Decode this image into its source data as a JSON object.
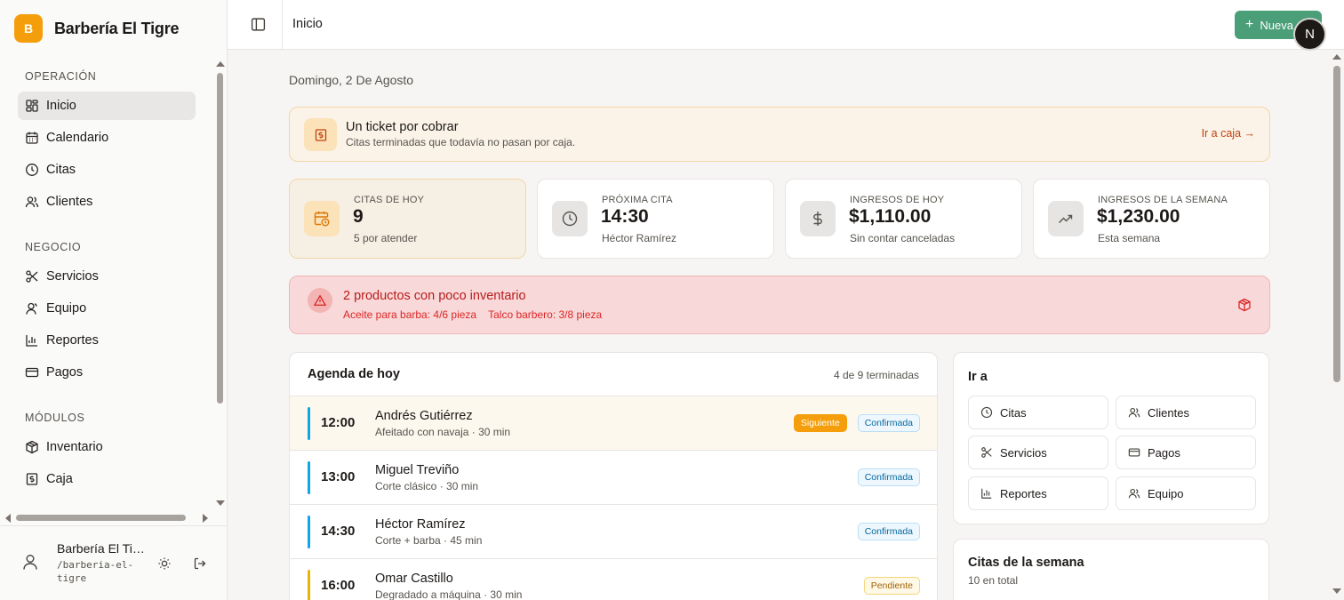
{
  "brand": {
    "initial": "B",
    "name": "Barbería El Tigre"
  },
  "sidebar": {
    "sections": [
      {
        "title": "OPERACIÓN",
        "items": [
          {
            "label": "Inicio",
            "icon": "grid-icon",
            "active": true
          },
          {
            "label": "Calendario",
            "icon": "calendar-icon"
          },
          {
            "label": "Citas",
            "icon": "clock-icon"
          },
          {
            "label": "Clientes",
            "icon": "users-icon"
          }
        ]
      },
      {
        "title": "NEGOCIO",
        "items": [
          {
            "label": "Servicios",
            "icon": "scissors-icon"
          },
          {
            "label": "Equipo",
            "icon": "team-icon"
          },
          {
            "label": "Reportes",
            "icon": "bar-chart-icon"
          },
          {
            "label": "Pagos",
            "icon": "credit-card-icon"
          }
        ]
      },
      {
        "title": "MÓDULOS",
        "items": [
          {
            "label": "Inventario",
            "icon": "box-icon"
          },
          {
            "label": "Caja",
            "icon": "cash-register-icon"
          }
        ]
      }
    ],
    "footer": {
      "name": "Barbería El Ti…",
      "slug": "/barberia-el-tigre"
    }
  },
  "header": {
    "title": "Inicio",
    "new_button": "Nueva",
    "avatar_initial": "N"
  },
  "main": {
    "date": "Domingo, 2 De Agosto",
    "ticket_banner": {
      "title": "Un ticket por cobrar",
      "subtitle": "Citas terminadas que todavía no pasan por caja.",
      "link": "Ir a caja →"
    },
    "stats": [
      {
        "label": "CITAS DE HOY",
        "value": "9",
        "sub": "5 por atender",
        "icon": "calendar-clock-icon"
      },
      {
        "label": "PRÓXIMA CITA",
        "value": "14:30",
        "sub": "Héctor Ramírez",
        "icon": "clock-icon"
      },
      {
        "label": "INGRESOS DE HOY",
        "value": "$1,110.00",
        "sub": "Sin contar canceladas",
        "icon": "dollar-icon"
      },
      {
        "label": "INGRESOS DE LA SEMANA",
        "value": "$1,230.00",
        "sub": "Esta semana",
        "icon": "trending-up-icon"
      }
    ],
    "inventory_alert": {
      "title": "2 productos con poco inventario",
      "items": [
        "Aceite para barba: 4/6 pieza",
        "Talco barbero: 3/8 pieza"
      ]
    },
    "agenda": {
      "title": "Agenda de hoy",
      "count": "4 de 9 terminadas",
      "rows": [
        {
          "time": "12:00",
          "name": "Andrés Gutiérrez",
          "service": "Afeitado con navaja · 30 min",
          "next_badge": "Siguiente",
          "status": "Confirmada",
          "bar_color": "#0ea5e9",
          "status_kind": "ok"
        },
        {
          "time": "13:00",
          "name": "Miguel Treviño",
          "service": "Corte clásico · 30 min",
          "status": "Confirmada",
          "bar_color": "#0ea5e9",
          "status_kind": "ok"
        },
        {
          "time": "14:30",
          "name": "Héctor Ramírez",
          "service": "Corte + barba · 45 min",
          "status": "Confirmada",
          "bar_color": "#0ea5e9",
          "status_kind": "ok"
        },
        {
          "time": "16:00",
          "name": "Omar Castillo",
          "service": "Degradado a máquina · 30 min",
          "status": "Pendiente",
          "bar_color": "#eab308",
          "status_kind": "pend"
        }
      ]
    },
    "goto": {
      "title": "Ir a",
      "links": [
        {
          "label": "Citas",
          "icon": "clock-icon"
        },
        {
          "label": "Clientes",
          "icon": "users-icon"
        },
        {
          "label": "Servicios",
          "icon": "scissors-icon"
        },
        {
          "label": "Pagos",
          "icon": "credit-card-icon"
        },
        {
          "label": "Reportes",
          "icon": "bar-chart-icon"
        },
        {
          "label": "Equipo",
          "icon": "users-icon"
        }
      ]
    },
    "week": {
      "title": "Citas de la semana",
      "subtitle": "10 en total"
    }
  },
  "colors": {
    "brand": "#f59e0b",
    "primary_button": "#4a9e78",
    "alert": "#dc2626",
    "banner": "#fbf3e8"
  }
}
